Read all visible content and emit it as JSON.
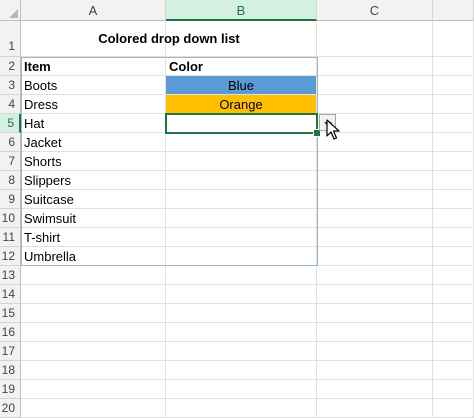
{
  "sheet": {
    "columns": [
      "A",
      "B",
      "C"
    ],
    "selected_column": "B",
    "selected_row": 5,
    "rows": [
      {
        "num": "1",
        "a": "",
        "b": ""
      },
      {
        "num": "2",
        "a": "Item",
        "b": "Color"
      },
      {
        "num": "3",
        "a": "Boots",
        "b": "Blue"
      },
      {
        "num": "4",
        "a": "Dress",
        "b": "Orange"
      },
      {
        "num": "5",
        "a": "Hat",
        "b": ""
      },
      {
        "num": "6",
        "a": "Jacket",
        "b": ""
      },
      {
        "num": "7",
        "a": "Shorts",
        "b": ""
      },
      {
        "num": "8",
        "a": "Slippers",
        "b": ""
      },
      {
        "num": "9",
        "a": "Suitcase",
        "b": ""
      },
      {
        "num": "10",
        "a": "Swimsuit",
        "b": ""
      },
      {
        "num": "11",
        "a": "T-shirt",
        "b": ""
      },
      {
        "num": "12",
        "a": "Umbrella",
        "b": ""
      },
      {
        "num": "13",
        "a": "",
        "b": ""
      },
      {
        "num": "14",
        "a": "",
        "b": ""
      },
      {
        "num": "15",
        "a": "",
        "b": ""
      },
      {
        "num": "16",
        "a": "",
        "b": ""
      },
      {
        "num": "17",
        "a": "",
        "b": ""
      },
      {
        "num": "18",
        "a": "",
        "b": ""
      },
      {
        "num": "19",
        "a": "",
        "b": ""
      },
      {
        "num": "20",
        "a": "",
        "b": ""
      }
    ],
    "title": "Colored drop down list",
    "cell_fills": {
      "Blue": "#5b9bd5",
      "Orange": "#ffc000"
    },
    "dropdown_icon": "chevron-down-icon",
    "cursor_icon": "mouse-pointer-icon"
  }
}
